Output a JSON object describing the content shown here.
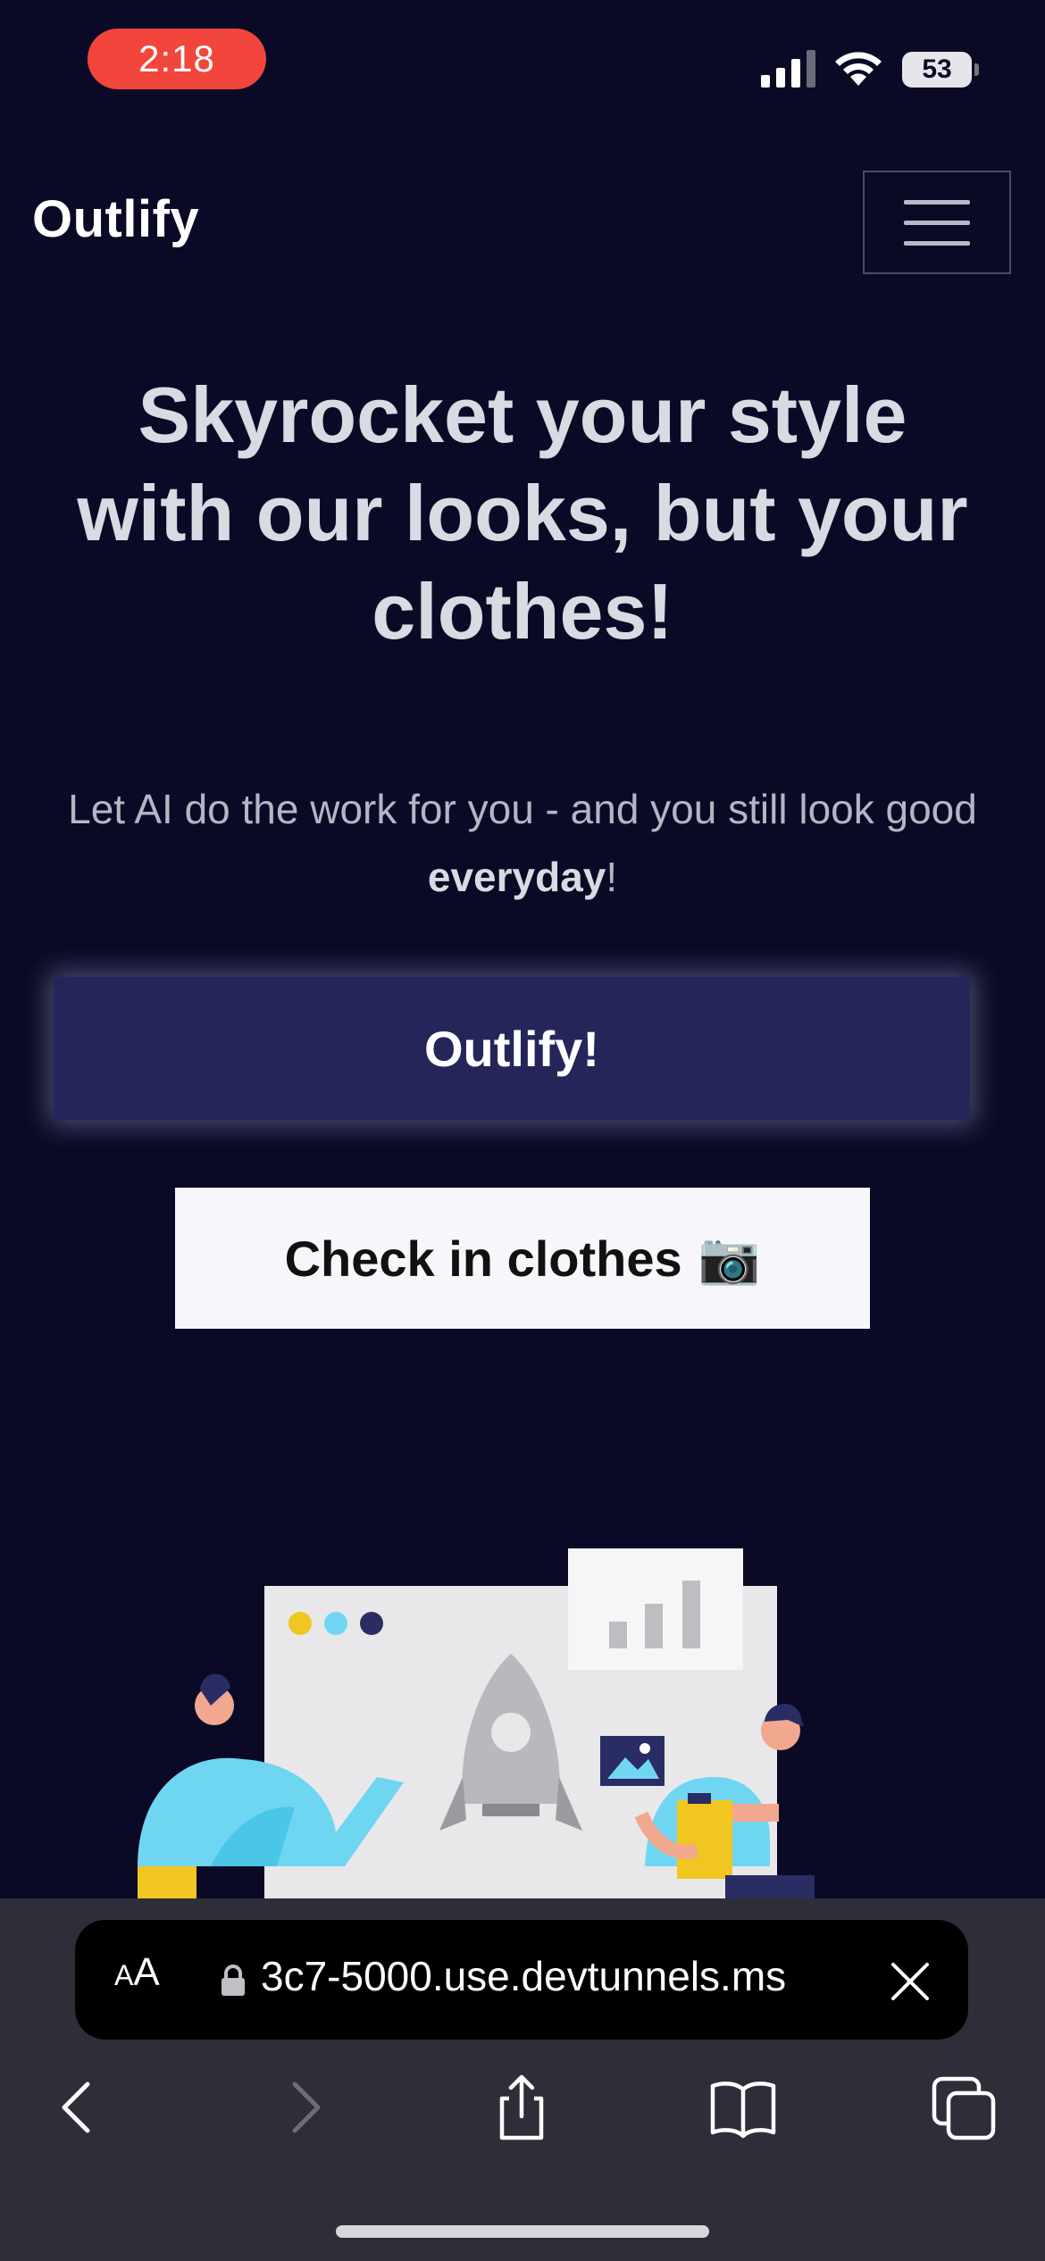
{
  "status": {
    "time": "2:18",
    "battery": "53"
  },
  "nav": {
    "brand": "Outlify"
  },
  "hero": {
    "title": "Skyrocket your style with our looks, but your clothes!",
    "subtitle_pre": "Let AI do the work for you - and you still look good ",
    "subtitle_bold": "everyday",
    "subtitle_post": "!"
  },
  "buttons": {
    "primary": "Outlify!",
    "secondary": "Check in clothes",
    "secondary_emoji": "📷"
  },
  "browser": {
    "aa_small": "A",
    "aa_large": "A",
    "url": "3c7-5000.use.devtunnels.ms"
  },
  "colors": {
    "background": "#0a0a26",
    "primary_button": "#24265a",
    "secondary_button": "#f7f7fb",
    "time_pill": "#f2463c"
  }
}
